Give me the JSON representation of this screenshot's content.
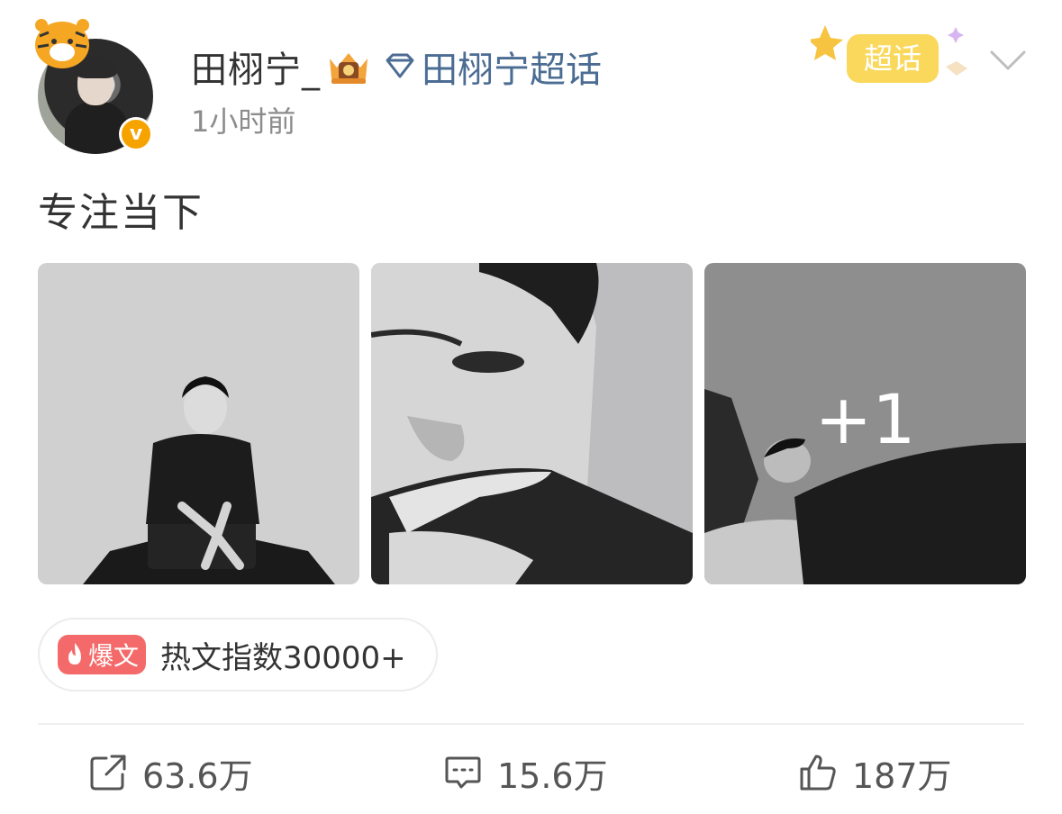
{
  "header": {
    "username": "田栩宁_",
    "topic_link": "田栩宁超话",
    "time": "1小时前",
    "chaohua_badge": "超话"
  },
  "post": {
    "text": "专注当下",
    "more_images_count": "+1"
  },
  "hot": {
    "tag": "爆文",
    "text": "热文指数30000+"
  },
  "actions": {
    "share_count": "63.6万",
    "comment_count": "15.6万",
    "like_count": "187万"
  },
  "colors": {
    "topic_link": "#4b6c93",
    "hot_tag": "#f46a6a",
    "verified_badge": "#f6a300"
  },
  "icons": [
    "tiger-icon",
    "verified-v-icon",
    "crown-icon",
    "diamond-icon",
    "chevron-down-icon",
    "flame-icon",
    "share-icon",
    "comment-icon",
    "like-icon"
  ]
}
